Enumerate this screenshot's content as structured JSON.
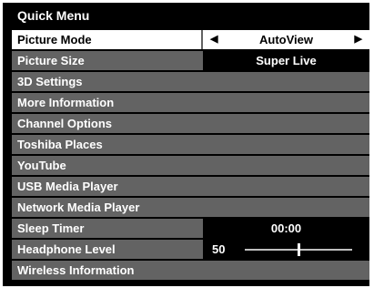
{
  "menu": {
    "title": "Quick Menu",
    "items": [
      {
        "label": "Picture Mode",
        "value": "AutoView"
      },
      {
        "label": "Picture Size",
        "value": "Super Live"
      },
      {
        "label": "3D Settings"
      },
      {
        "label": "More Information"
      },
      {
        "label": "Channel Options"
      },
      {
        "label": "Toshiba Places"
      },
      {
        "label": "YouTube"
      },
      {
        "label": "USB Media Player"
      },
      {
        "label": "Network Media Player"
      },
      {
        "label": "Sleep Timer",
        "value": "00:00"
      },
      {
        "label": "Headphone Level",
        "value": "50",
        "level_fraction": 0.5
      },
      {
        "label": "Wireless Information"
      }
    ]
  },
  "icons": {
    "left_arrow": "triangle-left",
    "right_arrow": "triangle-right"
  },
  "arrows": {
    "left": "◀",
    "right": "▶"
  }
}
